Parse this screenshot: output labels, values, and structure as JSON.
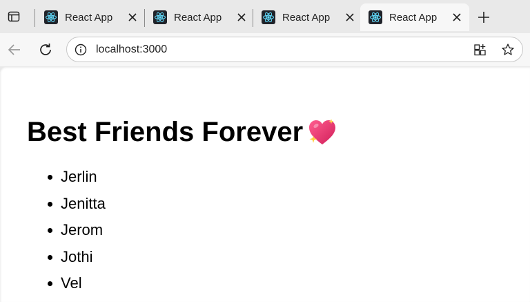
{
  "browser": {
    "tabs": [
      {
        "title": "React App",
        "active": false
      },
      {
        "title": "React App",
        "active": false
      },
      {
        "title": "React App",
        "active": false
      },
      {
        "title": "React App",
        "active": true
      }
    ],
    "address": {
      "url": "localhost:3000"
    }
  },
  "page": {
    "heading": "Best Friends Forever",
    "heading_emoji": "sparkling-heart",
    "friends": [
      "Jerlin",
      "Jenitta",
      "Jerom",
      "Jothi",
      "Vel"
    ]
  },
  "colors": {
    "react_cyan": "#61dafb",
    "favicon_bg": "#20232a",
    "heart_pink": "#e8356f"
  }
}
